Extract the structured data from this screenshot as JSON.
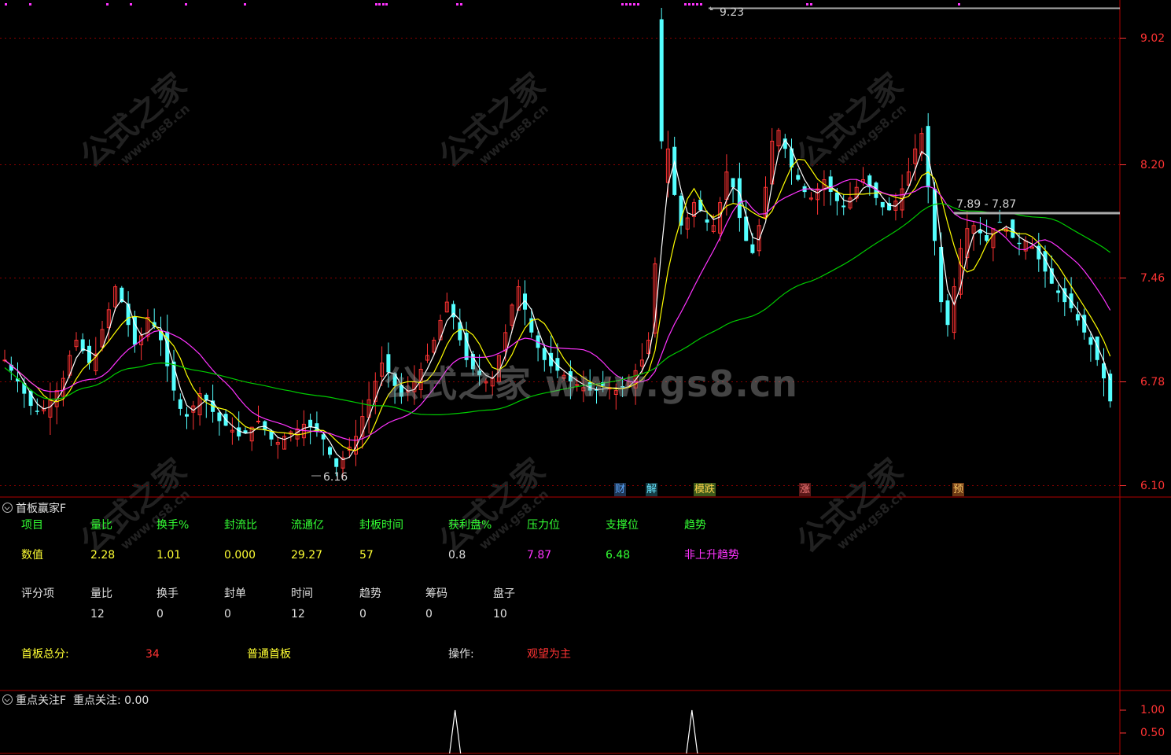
{
  "main_chart": {
    "peak_label": "9.23",
    "low_label": "6.16",
    "range_label": "7.89 - 7.87",
    "yticks": [
      "9.02",
      "8.20",
      "7.46",
      "6.78",
      "6.10"
    ],
    "tick_values": [
      9.02,
      8.2,
      7.46,
      6.78,
      6.1
    ],
    "badges": [
      {
        "text": "财",
        "color": "#5aa7ff",
        "bg": "#1f3552"
      },
      {
        "text": "解",
        "color": "#66e6ff",
        "bg": "#163c44"
      },
      {
        "text": "模跌",
        "color": "#ffd24a",
        "bg": "#3c5a1c"
      },
      {
        "text": "涨",
        "color": "#ff8080",
        "bg": "#5a1818"
      },
      {
        "text": "预",
        "color": "#ffcc66",
        "bg": "#6b3814"
      }
    ]
  },
  "chart_data": [
    {
      "type": "candlestick",
      "title": "",
      "annotations": [
        "9.23",
        "6.16",
        "7.89 - 7.87"
      ],
      "ylim": [
        6.1,
        9.23
      ],
      "yticks": [
        9.02,
        8.2,
        7.46,
        6.78,
        6.1
      ],
      "series": [
        {
          "color": "#ffffff",
          "values": []
        },
        {
          "color": "#ffff00",
          "values": []
        },
        {
          "color": "#ff33ff",
          "values": []
        },
        {
          "color": "#00cc00",
          "values": []
        }
      ],
      "close": [
        6.92,
        6.85,
        6.78,
        6.7,
        6.62,
        6.58,
        6.6,
        6.66,
        6.72,
        6.8,
        6.95,
        7.05,
        6.98,
        6.9,
        6.96,
        7.12,
        7.25,
        7.4,
        7.3,
        7.15,
        7.02,
        7.08,
        7.2,
        7.14,
        7.05,
        6.88,
        6.72,
        6.6,
        6.55,
        6.62,
        6.7,
        6.66,
        6.58,
        6.52,
        6.49,
        6.46,
        6.42,
        6.44,
        6.48,
        6.52,
        6.46,
        6.4,
        6.38,
        6.42,
        6.45,
        6.47,
        6.5,
        6.48,
        6.45,
        6.4,
        6.3,
        6.22,
        6.28,
        6.35,
        6.42,
        6.55,
        6.66,
        6.78,
        6.9,
        6.84,
        6.75,
        6.68,
        6.72,
        6.78,
        6.86,
        6.95,
        7.05,
        7.18,
        7.3,
        7.2,
        7.05,
        6.92,
        6.86,
        6.82,
        6.78,
        6.8,
        6.95,
        7.1,
        7.28,
        7.4,
        7.25,
        7.1,
        7.0,
        6.92,
        6.88,
        6.85,
        6.82,
        6.78,
        6.76,
        6.74,
        6.72,
        6.72,
        6.75,
        6.74,
        6.72,
        6.74,
        6.78,
        6.85,
        6.92,
        7.05,
        7.55,
        8.1,
        8.3,
        8.0,
        7.8,
        7.85,
        7.95,
        7.9,
        7.82,
        7.8,
        7.95,
        8.15,
        8.05,
        7.85,
        7.7,
        7.62,
        7.8,
        8.05,
        8.35,
        8.42,
        8.3,
        8.18,
        8.1,
        8.02,
        7.98,
        8.04,
        8.1,
        8.02,
        7.96,
        7.92,
        7.98,
        8.05,
        8.1,
        8.05,
        7.98,
        7.92,
        7.9,
        7.96,
        8.04,
        8.15,
        8.3,
        8.4,
        8.05,
        7.7,
        7.3,
        7.15,
        7.4,
        7.65,
        7.78,
        7.8,
        7.75,
        7.7,
        7.78,
        7.82,
        7.78,
        7.72,
        7.68,
        7.7,
        7.66,
        7.58,
        7.5,
        7.42,
        7.36,
        7.3,
        7.26,
        7.18,
        7.1,
        7.02,
        6.92,
        6.8,
        6.65
      ],
      "low_tick": 6.16,
      "high_tick": 9.23
    },
    {
      "type": "line",
      "title": "重点关注F",
      "value_label": "重点关注: 0.00",
      "ylim": [
        0,
        1.15
      ],
      "yticks": [
        1.0,
        0.5
      ],
      "spike_positions": [
        0.405,
        0.618
      ],
      "values_note": "",
      "series": [
        {
          "name": "重点关注",
          "color": "#ffffff",
          "values": [
            0,
            0,
            0,
            0,
            0,
            1,
            0,
            0,
            0,
            0,
            0,
            0,
            1,
            0,
            0,
            0,
            0,
            0,
            0,
            0
          ]
        }
      ]
    }
  ],
  "panel_first_board": {
    "title": "首板赢家F",
    "header": [
      "项目",
      "量比",
      "换手%",
      "封流比",
      "流通亿",
      "封板时间",
      "获利盘%",
      "压力位",
      "支撑位",
      "趋势"
    ],
    "values_label": "数值",
    "values": [
      "2.28",
      "1.01",
      "0.000",
      "29.27",
      "57",
      "0.8",
      "7.87",
      "6.48",
      "非上升趋势"
    ],
    "score_label": "评分项",
    "score_header": [
      "量比",
      "换手",
      "封单",
      "时间",
      "趋势",
      "筹码",
      "盘子"
    ],
    "scores": [
      "12",
      "0",
      "0",
      "12",
      "0",
      "0",
      "10"
    ],
    "total_label": "首板总分:",
    "total_value": "34",
    "board_type": "普通首板",
    "op_label": "操作:",
    "op_value": "观望为主"
  },
  "panel_focus": {
    "title": "重点关注F",
    "value_text": "重点关注: 0.00",
    "yticks": [
      "1.00",
      "0.50"
    ]
  },
  "watermark": {
    "text": "公式之家",
    "url": "www.gs8.cn",
    "center": "公式之家 www.gs8.cn"
  },
  "colors": {
    "grid": "#8b0000",
    "up": "#ff3333",
    "down": "#54ffff",
    "axis_text": "#ff3333",
    "ma5": "#ffffff",
    "ma10": "#ffff00",
    "ma20": "#ff33ff",
    "ma60": "#00cc00"
  }
}
